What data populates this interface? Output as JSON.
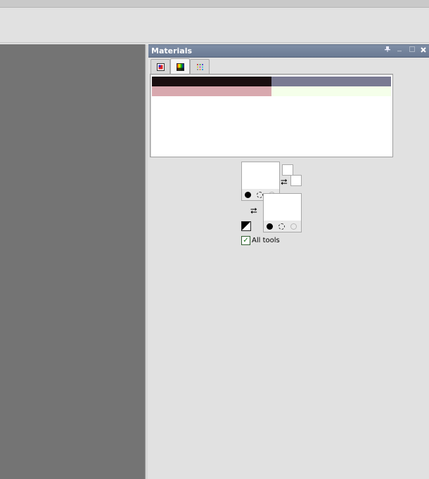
{
  "palette": {
    "title": "Materials",
    "header_icons": {
      "pin": "pin-icon",
      "minimize": "minimize-icon",
      "maximize": "maximize-icon",
      "close": "close-icon"
    },
    "tabs": [
      {
        "id": "frame",
        "icon": "frame-icon",
        "active": false
      },
      {
        "id": "rainbow",
        "icon": "rainbow-icon",
        "active": true
      },
      {
        "id": "swatches",
        "icon": "swatches-icon",
        "active": false
      }
    ],
    "swatches": [
      "#1a0f10",
      "#7a7a92",
      "#d8a8ae",
      "#f5ffea"
    ],
    "foreground": {
      "color": "#ffffff"
    },
    "background": {
      "color": "#ffffff"
    },
    "all_tools": {
      "label": "All tools",
      "checked": true
    }
  }
}
